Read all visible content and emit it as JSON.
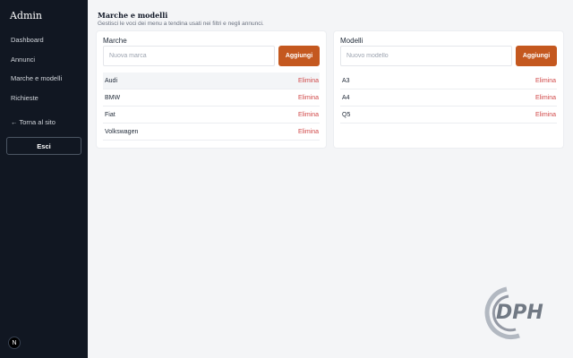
{
  "sidebar": {
    "title": "Admin",
    "nav": [
      {
        "label": "Dashboard"
      },
      {
        "label": "Annunci"
      },
      {
        "label": "Marche e modelli"
      },
      {
        "label": "Richieste"
      }
    ],
    "back_link": "← Torna al sito",
    "logout_label": "Esci",
    "badge": "N"
  },
  "header": {
    "title": "Marche e modelli",
    "subtitle": "Gestisci le voci dei menu a tendina usati nei filtri e negli annunci."
  },
  "brands": {
    "title": "Marche",
    "placeholder": "Nuova marca",
    "add_label": "Aggiungi",
    "items": [
      {
        "name": "Audi",
        "action": "Elimina"
      },
      {
        "name": "BMW",
        "action": "Elimina"
      },
      {
        "name": "Fiat",
        "action": "Elimina"
      },
      {
        "name": "Volkswagen",
        "action": "Elimina"
      }
    ]
  },
  "models": {
    "title": "Modelli",
    "placeholder": "Nuovo modello",
    "add_label": "Aggiungi",
    "items": [
      {
        "name": "A3",
        "action": "Elimina"
      },
      {
        "name": "A4",
        "action": "Elimina"
      },
      {
        "name": "Q5",
        "action": "Elimina"
      }
    ]
  },
  "watermark": {
    "text": "DPH"
  },
  "colors": {
    "sidebar_bg": "#111722",
    "accent": "#c4581f",
    "danger": "#d04848",
    "page_bg": "#f4f5f7"
  }
}
